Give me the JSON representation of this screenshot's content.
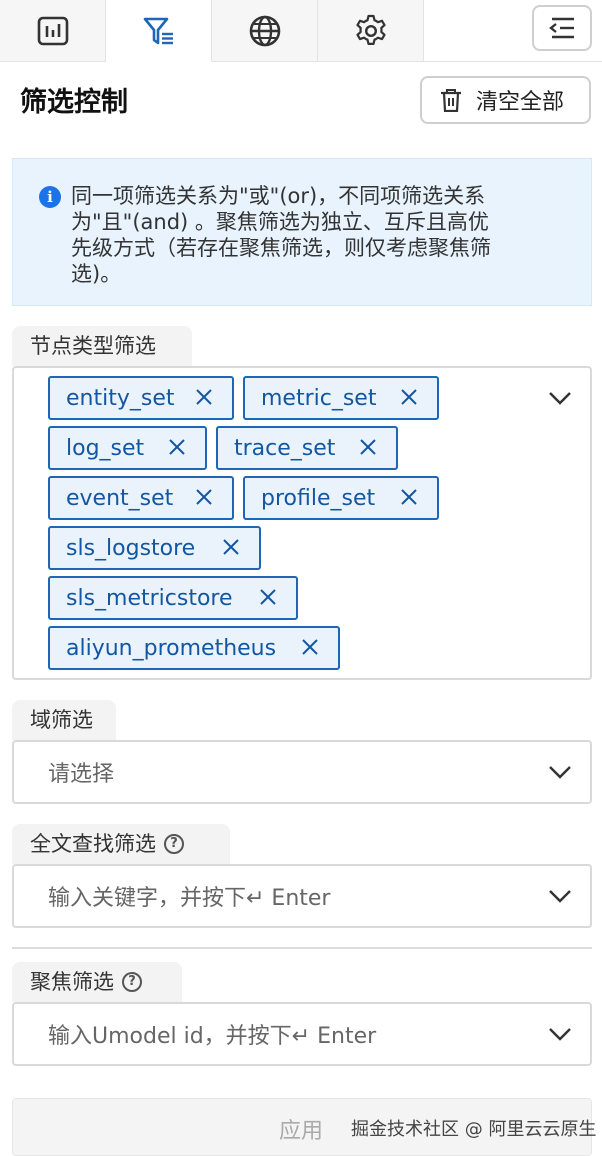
{
  "tabs": [
    {
      "icon": "bar-chart-icon",
      "active": false
    },
    {
      "icon": "filter-icon",
      "active": true
    },
    {
      "icon": "globe-icon",
      "active": false
    },
    {
      "icon": "gear-icon",
      "active": false
    }
  ],
  "accent_color": "#1f66b6",
  "header": {
    "title": "筛选控制",
    "clear_all_label": "清空全部"
  },
  "info": {
    "lines": [
      "同一项筛选关系为\"或\"(or)，不同项筛选关系",
      "为\"且\"(and) 。聚焦筛选为独立、互斥且高优",
      "先级方式（若存在聚焦筛选，则仅考虑聚焦筛",
      "选)。"
    ]
  },
  "node_type_filter": {
    "label": "节点类型筛选",
    "tags": [
      "entity_set",
      "metric_set",
      "log_set",
      "trace_set",
      "event_set",
      "profile_set",
      "sls_logstore",
      "sls_metricstore",
      "aliyun_prometheus"
    ]
  },
  "domain_filter": {
    "label": "域筛选",
    "placeholder": "请选择"
  },
  "fulltext_filter": {
    "label": "全文查找筛选",
    "placeholder": "输入关键字，并按下↵ Enter"
  },
  "focus_filter": {
    "label": "聚焦筛选",
    "placeholder": "输入Umodel id，并按下↵ Enter"
  },
  "footer": {
    "apply_label": "应用",
    "watermark": "掘金技术社区 @ 阿里云云原生"
  }
}
